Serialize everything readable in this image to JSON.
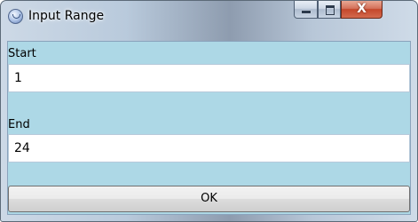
{
  "window": {
    "title": "Input Range",
    "app_icon": "app-icon",
    "controls": {
      "minimize_icon": "minimize-icon",
      "maximize_icon": "maximize-icon",
      "close_glyph": "X"
    }
  },
  "form": {
    "start_label": "Start",
    "start_value": "1",
    "end_label": "End",
    "end_value": "24",
    "ok_label": "OK"
  },
  "colors": {
    "client_background": "#add8e6",
    "field_background": "#ffffff"
  }
}
